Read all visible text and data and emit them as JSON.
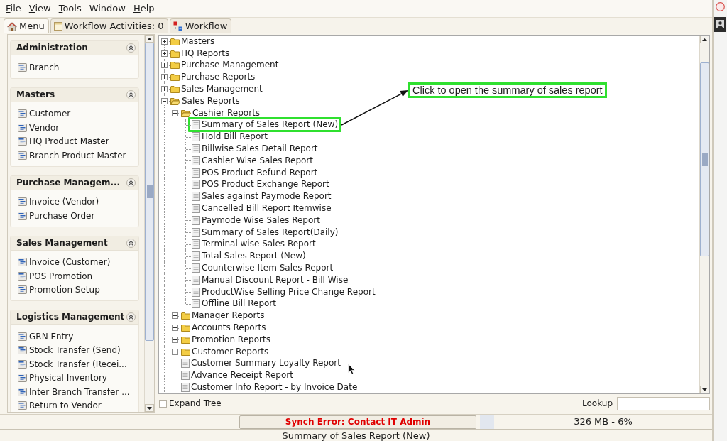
{
  "menu_bar": [
    {
      "label": "File",
      "mnemonic": true
    },
    {
      "label": "View",
      "mnemonic": true
    },
    {
      "label": "Tools",
      "mnemonic": true
    },
    {
      "label": "Window",
      "mnemonic": false
    },
    {
      "label": "Help",
      "mnemonic": true
    }
  ],
  "tabs": [
    {
      "label": "Menu",
      "kind": "home",
      "selected": true
    },
    {
      "label": "Workflow Activities: 0",
      "kind": "activities",
      "selected": false
    },
    {
      "label": "Workflow",
      "kind": "workflow",
      "selected": false
    }
  ],
  "sidebar": {
    "sections": [
      {
        "title": "Administration",
        "expanded": true,
        "items": [
          "Branch"
        ]
      },
      {
        "title": "Masters",
        "expanded": true,
        "items": [
          "Customer",
          "Vendor",
          "HQ Product Master",
          "Branch Product Master"
        ]
      },
      {
        "title": "Purchase Managem...",
        "expanded": true,
        "items": [
          "Invoice (Vendor)",
          "Purchase Order"
        ]
      },
      {
        "title": "Sales Management",
        "expanded": true,
        "items": [
          "Invoice (Customer)",
          "POS Promotion",
          "Promotion Setup"
        ]
      },
      {
        "title": "Logistics Management",
        "expanded": true,
        "items": [
          "GRN Entry",
          "Stock Transfer (Send)",
          "Stock Transfer (Recei...",
          "Physical Inventory",
          "Inter Branch Transfer ...",
          "Return to Vendor"
        ]
      }
    ]
  },
  "tree": [
    {
      "label": "Masters",
      "kind": "folder",
      "expanded": false,
      "highlighted": false
    },
    {
      "label": "HQ Reports",
      "kind": "folder",
      "expanded": false,
      "highlighted": false
    },
    {
      "label": "Purchase Management",
      "kind": "folder",
      "expanded": false,
      "highlighted": false
    },
    {
      "label": "Purchase Reports",
      "kind": "folder",
      "expanded": false,
      "highlighted": false
    },
    {
      "label": "Sales Management",
      "kind": "folder",
      "expanded": false,
      "highlighted": false
    },
    {
      "label": "Sales Reports",
      "kind": "folder",
      "expanded": true,
      "highlighted": false,
      "children": [
        {
          "label": "Cashier Reports",
          "kind": "folder",
          "expanded": true,
          "highlighted": false,
          "children": [
            {
              "label": "Summary of Sales Report (New)",
              "kind": "report",
              "highlighted": true
            },
            {
              "label": "Hold Bill Report",
              "kind": "report",
              "highlighted": false
            },
            {
              "label": "Billwise Sales Detail Report",
              "kind": "report",
              "highlighted": false
            },
            {
              "label": "Cashier Wise Sales Report",
              "kind": "report",
              "highlighted": false
            },
            {
              "label": "POS Product Refund Report",
              "kind": "report",
              "highlighted": false
            },
            {
              "label": "POS Product Exchange Report",
              "kind": "report",
              "highlighted": false
            },
            {
              "label": "Sales against Paymode Report",
              "kind": "report",
              "highlighted": false
            },
            {
              "label": "Cancelled Bill Report Itemwise",
              "kind": "report",
              "highlighted": false
            },
            {
              "label": "Paymode Wise Sales Report",
              "kind": "report",
              "highlighted": false
            },
            {
              "label": "Summary of Sales Report(Daily)",
              "kind": "report",
              "highlighted": false
            },
            {
              "label": "Terminal wise Sales Report",
              "kind": "report",
              "highlighted": false
            },
            {
              "label": "Total Sales Report (New)",
              "kind": "report",
              "highlighted": false
            },
            {
              "label": "Counterwise Item Sales Report",
              "kind": "report",
              "highlighted": false
            },
            {
              "label": "Manual Discount Report - Bill Wise",
              "kind": "report",
              "highlighted": false
            },
            {
              "label": "ProductWise Selling Price Change Report",
              "kind": "report",
              "highlighted": false
            },
            {
              "label": "Offline Bill Report",
              "kind": "report",
              "highlighted": false
            }
          ]
        },
        {
          "label": "Manager Reports",
          "kind": "folder",
          "expanded": false,
          "highlighted": false
        },
        {
          "label": "Accounts Reports",
          "kind": "folder",
          "expanded": false,
          "highlighted": false
        },
        {
          "label": "Promotion Reports",
          "kind": "folder",
          "expanded": false,
          "highlighted": false
        },
        {
          "label": "Customer Reports",
          "kind": "folder",
          "expanded": false,
          "highlighted": false
        },
        {
          "label": "Customer Summary Loyalty Report",
          "kind": "report",
          "highlighted": false
        },
        {
          "label": "Advance Receipt Report",
          "kind": "report",
          "highlighted": false
        },
        {
          "label": "Customer Info Report - by Invoice Date",
          "kind": "report",
          "highlighted": false
        }
      ]
    }
  ],
  "annotation": {
    "text": "Click to open the summary of sales report"
  },
  "expand_tree": {
    "label": "Expand Tree",
    "checked": false
  },
  "lookup": {
    "label": "Lookup"
  },
  "status_bar": {
    "error": "Synch Error: Contact IT Admin",
    "memory": "326 MB - 6%"
  },
  "footer": {
    "current_report": "Summary of Sales Report (New)"
  }
}
